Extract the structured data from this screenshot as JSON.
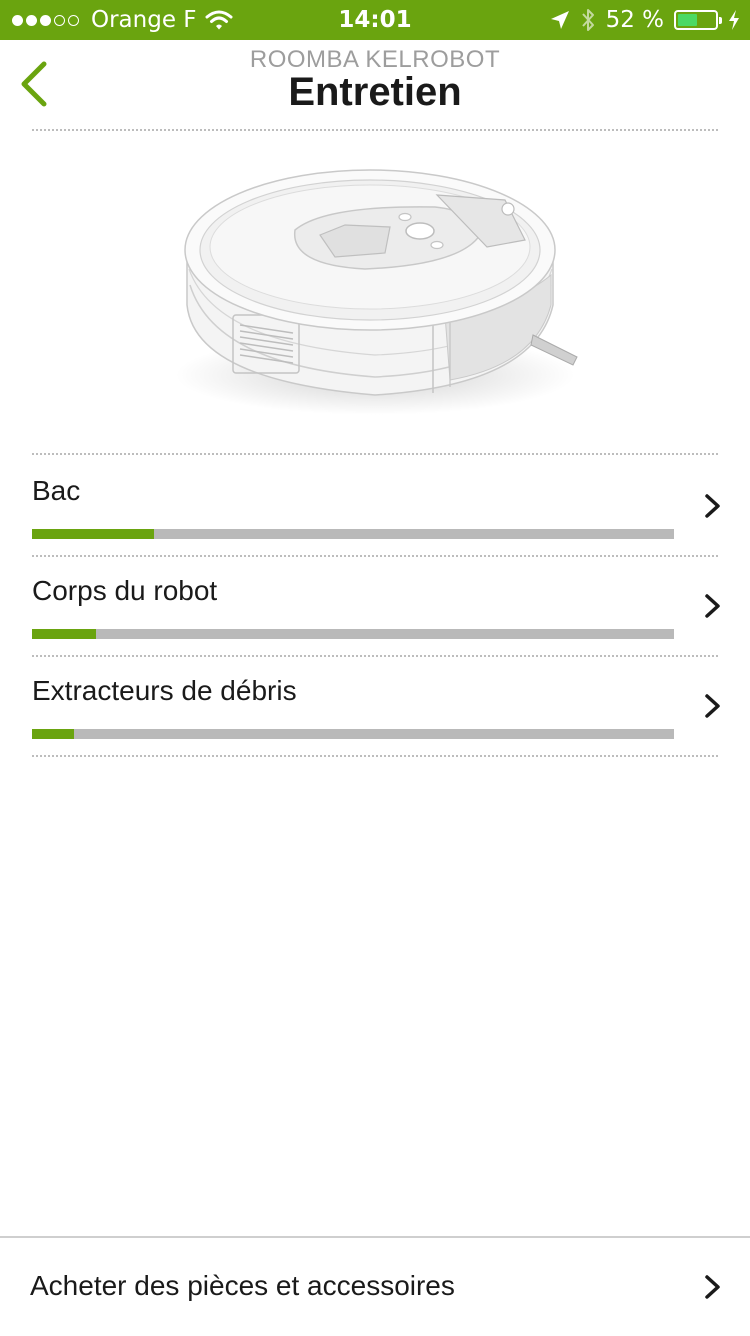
{
  "status_bar": {
    "carrier": "Orange F",
    "time": "14:01",
    "battery_percent": "52 %",
    "battery_level": 0.52,
    "signal_bars_filled": 3,
    "signal_bars_total": 5
  },
  "header": {
    "robot_name": "ROOMBA KELROBOT",
    "title": "Entretien"
  },
  "maintenance_items": [
    {
      "label": "Bac",
      "level": 0.19
    },
    {
      "label": "Corps du robot",
      "level": 0.1
    },
    {
      "label": "Extracteurs de débris",
      "level": 0.065
    }
  ],
  "shop": {
    "label": "Acheter des pièces et accessoires"
  },
  "colors": {
    "accent": "#6aa40f",
    "track": "#b9b9b9",
    "battery": "#4cd964"
  }
}
